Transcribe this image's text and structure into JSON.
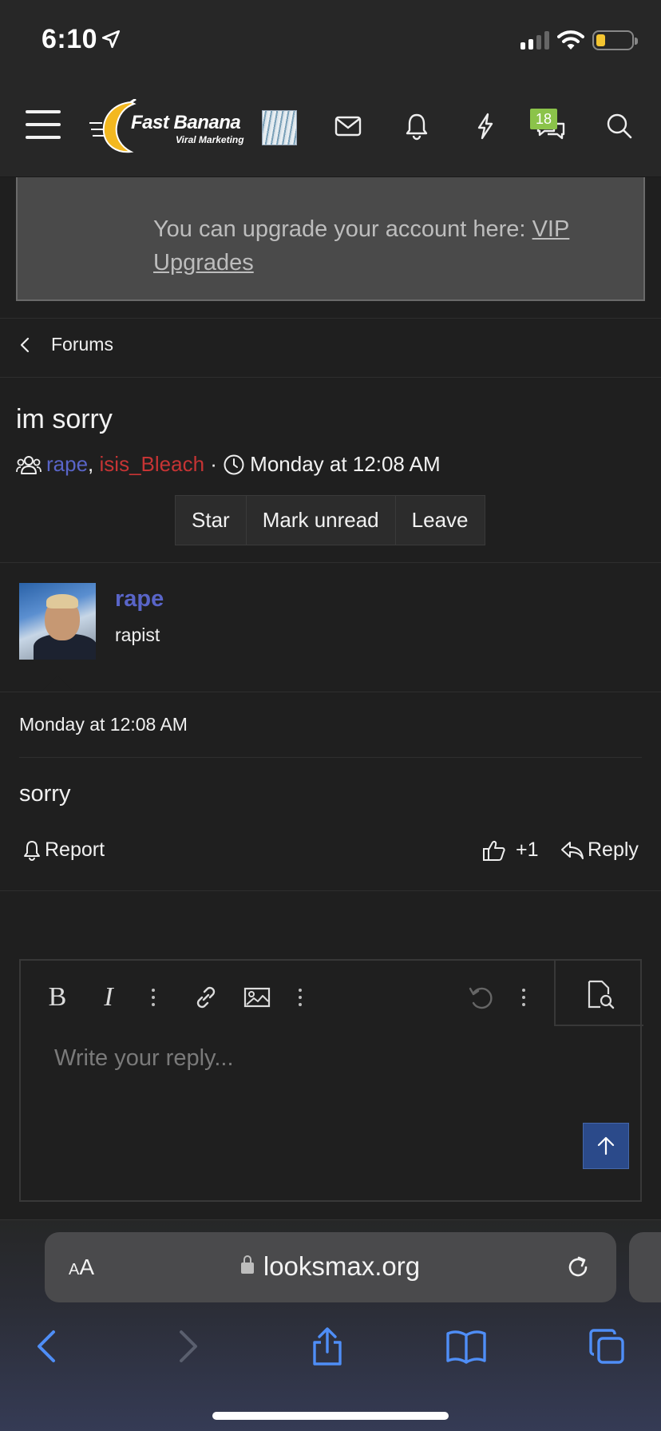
{
  "status": {
    "time": "6:10"
  },
  "header": {
    "logo_title": "Fast Banana",
    "logo_subtitle": "Viral Marketing",
    "conversations_badge": "18"
  },
  "notice": {
    "text": "You can upgrade your account here: ",
    "link": "VIP Upgrades"
  },
  "breadcrumb": {
    "label": "Forums"
  },
  "thread": {
    "title": "im sorry",
    "participants": [
      "rape",
      "isis_Bleach"
    ],
    "separator": ",",
    "dot": "·",
    "date": "Monday at 12:08 AM",
    "buttons": [
      "Star",
      "Mark unread",
      "Leave"
    ]
  },
  "post": {
    "username": "rape",
    "user_title": "rapist",
    "date": "Monday at 12:08 AM",
    "body": "sorry",
    "report_label": "Report",
    "like_label": "+1",
    "reply_label": "Reply"
  },
  "editor": {
    "placeholder": "Write your reply..."
  },
  "browser": {
    "text_size_label_small": "A",
    "text_size_label_large": "A",
    "url": "looksmax.org"
  },
  "colors": {
    "user_blue": "#5965c8",
    "user_red": "#c63434",
    "badge_green": "#8bc34a",
    "accent_blue": "#2b4a8a",
    "safari_blue": "#4f8ef7"
  }
}
